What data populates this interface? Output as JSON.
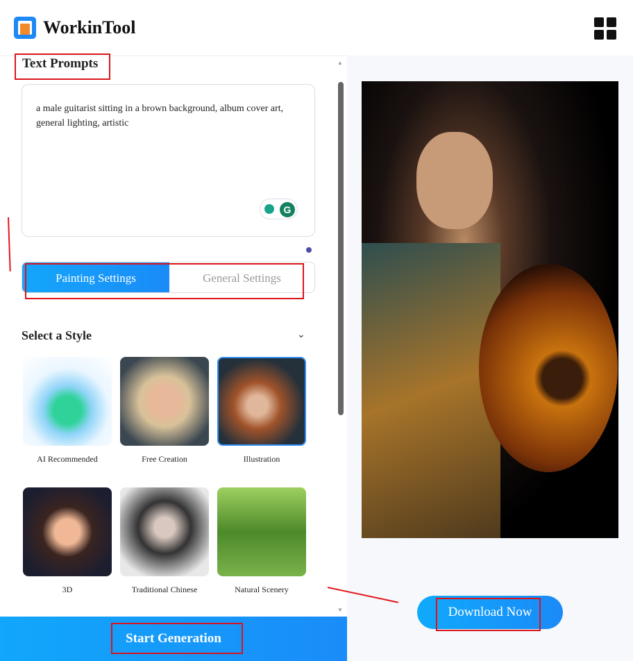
{
  "header": {
    "brand": "WorkinTool",
    "apps_icon": "grid-apps-icon"
  },
  "prompts": {
    "title": "Text Prompts",
    "text": "a male guitarist sitting in a brown background, album cover art, general lighting, artistic"
  },
  "tabs": [
    {
      "label": "Painting Settings",
      "active": true
    },
    {
      "label": "General Settings",
      "active": false
    }
  ],
  "style": {
    "title": "Select a Style",
    "items": [
      {
        "label": "AI Recommended",
        "selected": false
      },
      {
        "label": "Free Creation",
        "selected": false
      },
      {
        "label": "Illustration",
        "selected": true
      },
      {
        "label": "3D",
        "selected": false
      },
      {
        "label": "Traditional Chinese",
        "selected": false
      },
      {
        "label": "Natural Scenery",
        "selected": false
      }
    ]
  },
  "actions": {
    "start": "Start Generation",
    "download": "Download Now"
  },
  "colors": {
    "accent": "#1a8cf9",
    "annotation": "#d9141b"
  }
}
